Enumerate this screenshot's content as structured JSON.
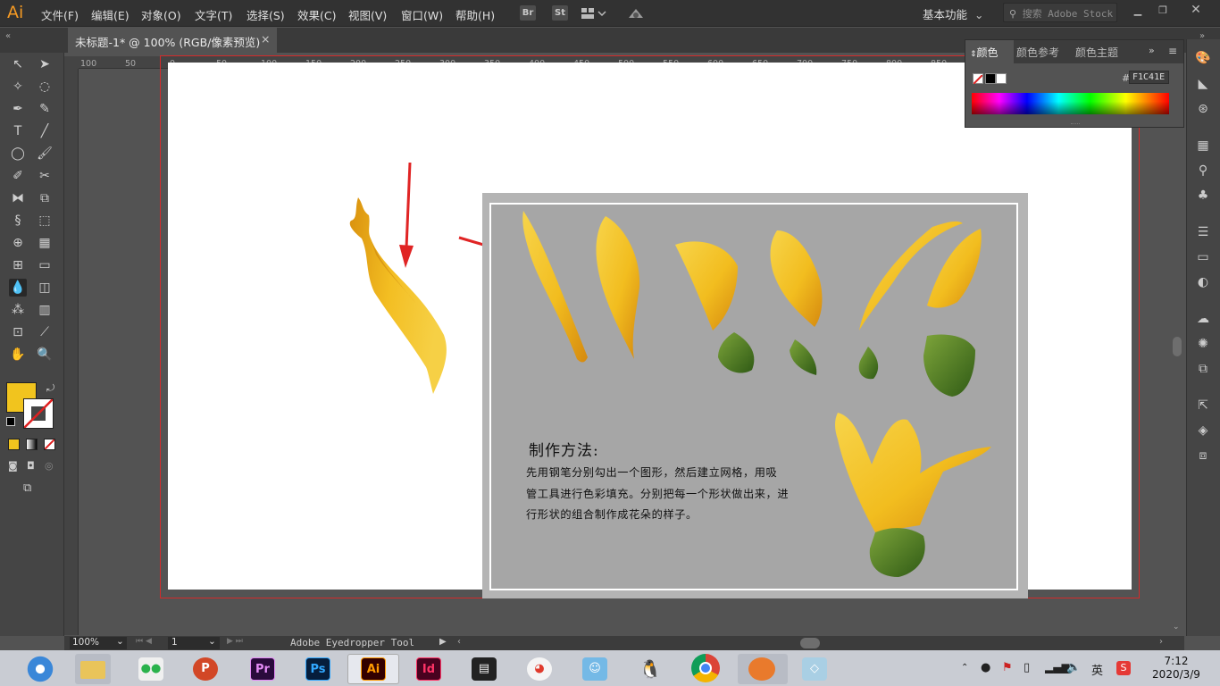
{
  "app": {
    "logo": "Ai",
    "title": "Adobe Illustrator"
  },
  "menus": [
    "文件(F)",
    "编辑(E)",
    "对象(O)",
    "文字(T)",
    "选择(S)",
    "效果(C)",
    "视图(V)",
    "窗口(W)",
    "帮助(H)"
  ],
  "toolbar_buttons": {
    "br": "Br",
    "st": "St"
  },
  "workspace": "基本功能",
  "search": {
    "placeholder": "搜索 Adobe Stock"
  },
  "document_tab": {
    "label": "未标题-1* @ 100% (RGB/像素预览)",
    "close": "×"
  },
  "rulers": {
    "h": [
      "100",
      "50",
      "0",
      "50",
      "100",
      "150",
      "200",
      "250",
      "300",
      "350",
      "400",
      "450",
      "500",
      "550",
      "600",
      "650",
      "700",
      "750",
      "800",
      "850"
    ]
  },
  "color_panel": {
    "tabs": [
      "颜色",
      "颜色参考",
      "颜色主题"
    ],
    "hash": "#",
    "hex": "F1C41E",
    "fill": "#F1C41E"
  },
  "artwork": {
    "title": "制作方法:",
    "lines": [
      "先用钢笔分别勾出一个图形，然后建立网格，用吸",
      "管工具进行色彩填充。分别把每一个形状做出来，进",
      "行形状的组合制作成花朵的样子。"
    ]
  },
  "status": {
    "zoom": "100%",
    "page": "1",
    "tool": "Adobe Eyedropper Tool"
  },
  "taskbar": {
    "apps": [
      "browser",
      "files",
      "wechat",
      "powerpoint",
      "premiere",
      "photoshop",
      "illustrator",
      "indesign",
      "video",
      "app-red",
      "app-blue",
      "qq",
      "chrome",
      "app-orange",
      "app-paper"
    ],
    "ime": "英",
    "time": "7:12",
    "date": "2020/3/9"
  }
}
